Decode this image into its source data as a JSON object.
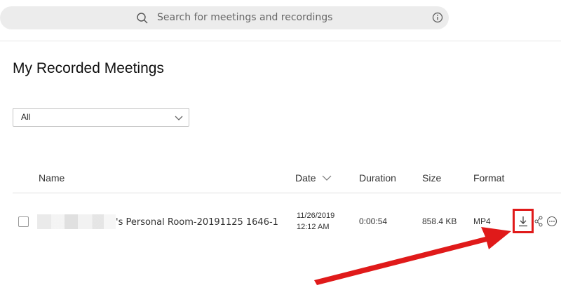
{
  "search": {
    "placeholder": "Search for meetings and recordings"
  },
  "page": {
    "title": "My Recorded Meetings"
  },
  "filter": {
    "selected": "All"
  },
  "table": {
    "columns": {
      "name": "Name",
      "date": "Date",
      "duration": "Duration",
      "size": "Size",
      "format": "Format"
    },
    "rows": [
      {
        "name": "'s Personal Room-20191125 1646-1",
        "date_line1": "11/26/2019",
        "date_line2": "12:12 AM",
        "duration": "0:00:54",
        "size": "858.4 KB",
        "format": "MP4"
      }
    ]
  },
  "icons": {
    "search": "search-icon",
    "info": "info-icon",
    "chevron": "chevron-down-icon",
    "sort": "sort-arrow-icon",
    "download": "download-icon",
    "share": "share-icon",
    "more": "more-icon"
  },
  "colors": {
    "annotation_red": "#e01a1a",
    "search_bg": "#ececec"
  }
}
